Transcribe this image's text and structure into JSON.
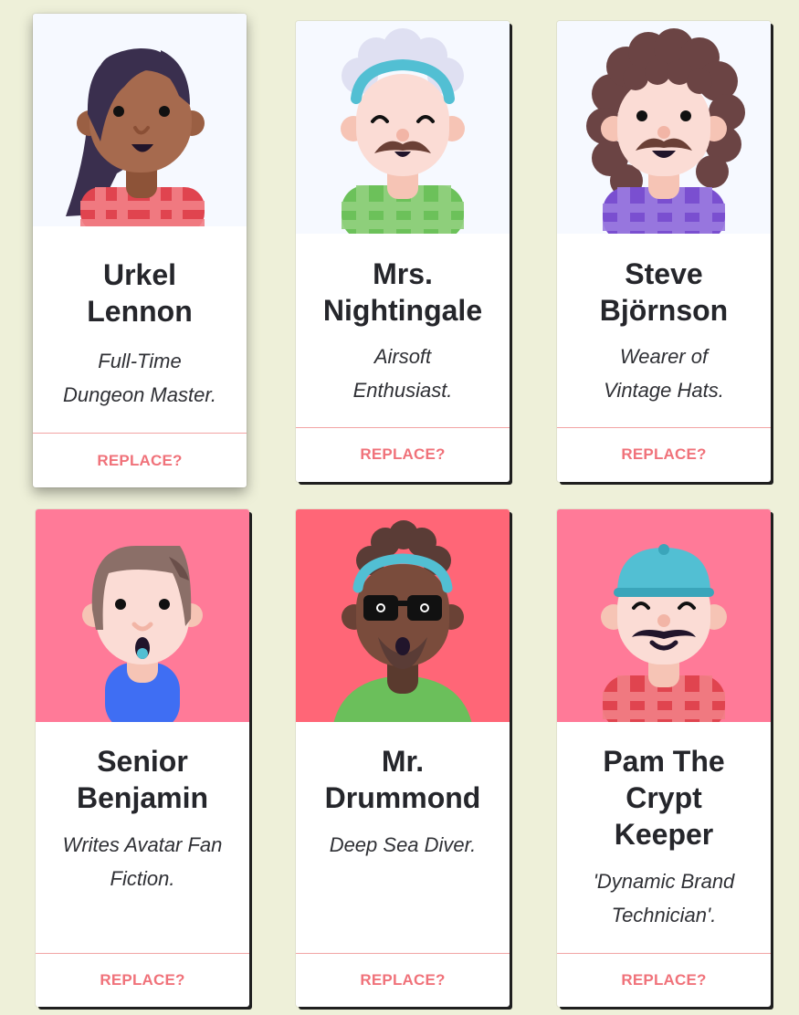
{
  "cards": [
    {
      "name_line1": "Urkel",
      "name_line2": "Lennon",
      "name_line3": "",
      "tagline_line1": "Full-Time",
      "tagline_line2": "Dungeon Master.",
      "action": "REPLACE?",
      "avatar": "woman-long-dark-hair",
      "portrait_bg": "#f6f9ff"
    },
    {
      "name_line1": "Mrs.",
      "name_line2": "Nightingale",
      "name_line3": "",
      "tagline_line1": "Airsoft",
      "tagline_line2": "Enthusiast.",
      "action": "REPLACE?",
      "avatar": "grey-hair-headband-mustache",
      "portrait_bg": "#f6f9ff"
    },
    {
      "name_line1": "Steve",
      "name_line2": "Björnson",
      "name_line3": "",
      "tagline_line1": "Wearer of",
      "tagline_line2": "Vintage Hats.",
      "action": "REPLACE?",
      "avatar": "curly-hair-mustache",
      "portrait_bg": "#f6f9ff"
    },
    {
      "name_line1": "Senior",
      "name_line2": "Benjamin",
      "name_line3": "",
      "tagline_line1": "Writes Avatar Fan",
      "tagline_line2": "Fiction.",
      "action": "REPLACE?",
      "avatar": "brown-hair-surprised",
      "portrait_bg": "#ff7a98"
    },
    {
      "name_line1": "Mr.",
      "name_line2": "Drummond",
      "name_line3": "",
      "tagline_line1": "Deep Sea Diver.",
      "tagline_line2": "",
      "action": "REPLACE?",
      "avatar": "glasses-beard",
      "portrait_bg": "#ff6677"
    },
    {
      "name_line1": "Pam The",
      "name_line2": "Crypt",
      "name_line3": "Keeper",
      "tagline_line1": "'Dynamic Brand",
      "tagline_line2": "Technician'.",
      "action": "REPLACE?",
      "avatar": "cap-mustache",
      "portrait_bg": "#ff7a98"
    }
  ]
}
